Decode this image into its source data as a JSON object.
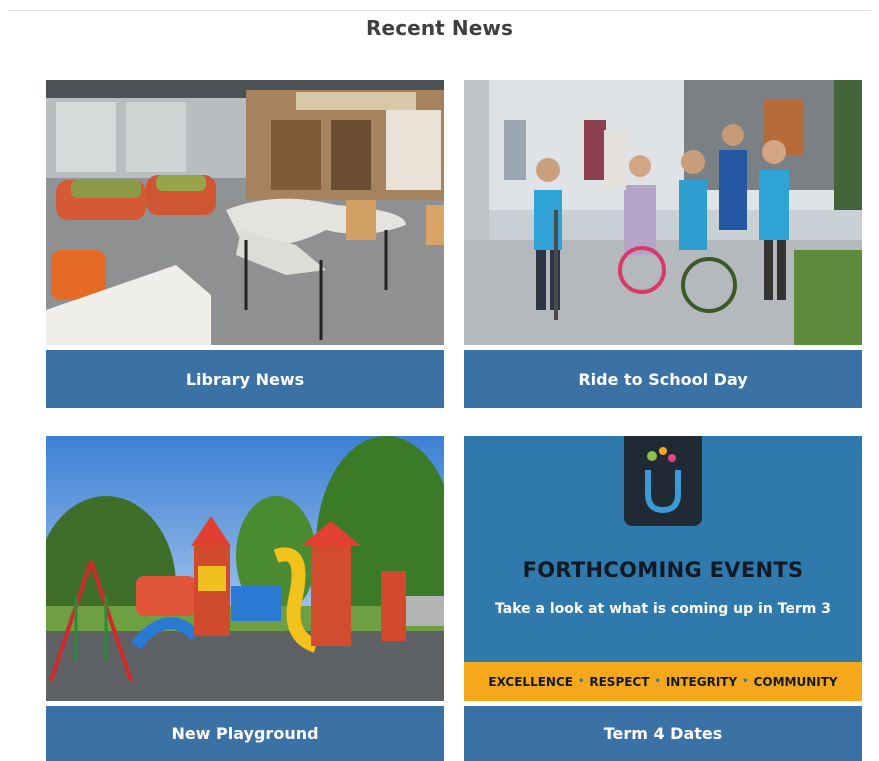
{
  "section": {
    "title": "Recent News"
  },
  "cards": [
    {
      "caption": "Library News",
      "image": "library-interior-photo"
    },
    {
      "caption": "Ride to School Day",
      "image": "students-riding-bikes-photo"
    },
    {
      "caption": "New Playground",
      "image": "playground-photo"
    },
    {
      "caption": "Term 4 Dates",
      "image": "forthcoming-events-banner"
    }
  ],
  "events_banner": {
    "title": "FORTHCOMING EVENTS",
    "subtitle": "Take a look at what is coming up in Term 3",
    "values": [
      "EXCELLENCE",
      "RESPECT",
      "INTEGRITY",
      "COMMUNITY"
    ],
    "separator": "•"
  },
  "colors": {
    "caption_bg": "#3a72a6",
    "banner_bg": "#2f79ad",
    "strip_bg": "#f6a81c",
    "title_text": "#3f3f3f"
  }
}
